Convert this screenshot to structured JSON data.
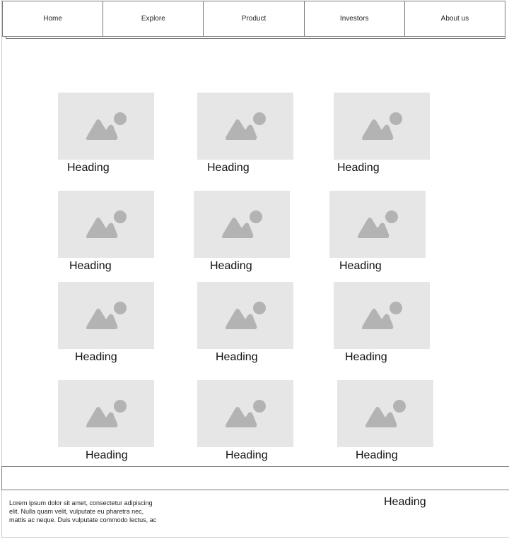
{
  "nav": {
    "items": [
      {
        "label": "Home"
      },
      {
        "label": "Explore"
      },
      {
        "label": "Product"
      },
      {
        "label": "Investors"
      },
      {
        "label": "About us"
      }
    ]
  },
  "grid": {
    "placeholder_icon": "image-placeholder-icon",
    "placeholder_color": "#e6e6e6",
    "icon_color": "#b3b3b3",
    "cards": [
      {
        "heading": "Heading"
      },
      {
        "heading": "Heading"
      },
      {
        "heading": "Heading"
      },
      {
        "heading": "Heading"
      },
      {
        "heading": "Heading"
      },
      {
        "heading": "Heading"
      },
      {
        "heading": "Heading"
      },
      {
        "heading": "Heading"
      },
      {
        "heading": "Heading"
      },
      {
        "heading": "Heading"
      },
      {
        "heading": "Heading"
      },
      {
        "heading": "Heading"
      }
    ]
  },
  "footer": {
    "text_lines": [
      "Lorem ipsum dolor sit amet, consectetur adipiscing",
      "elit. Nulla quam velit, vulputate eu pharetra nec,",
      "mattis ac neque. Duis vulputate commodo lectus, ac"
    ],
    "heading": "Heading"
  }
}
